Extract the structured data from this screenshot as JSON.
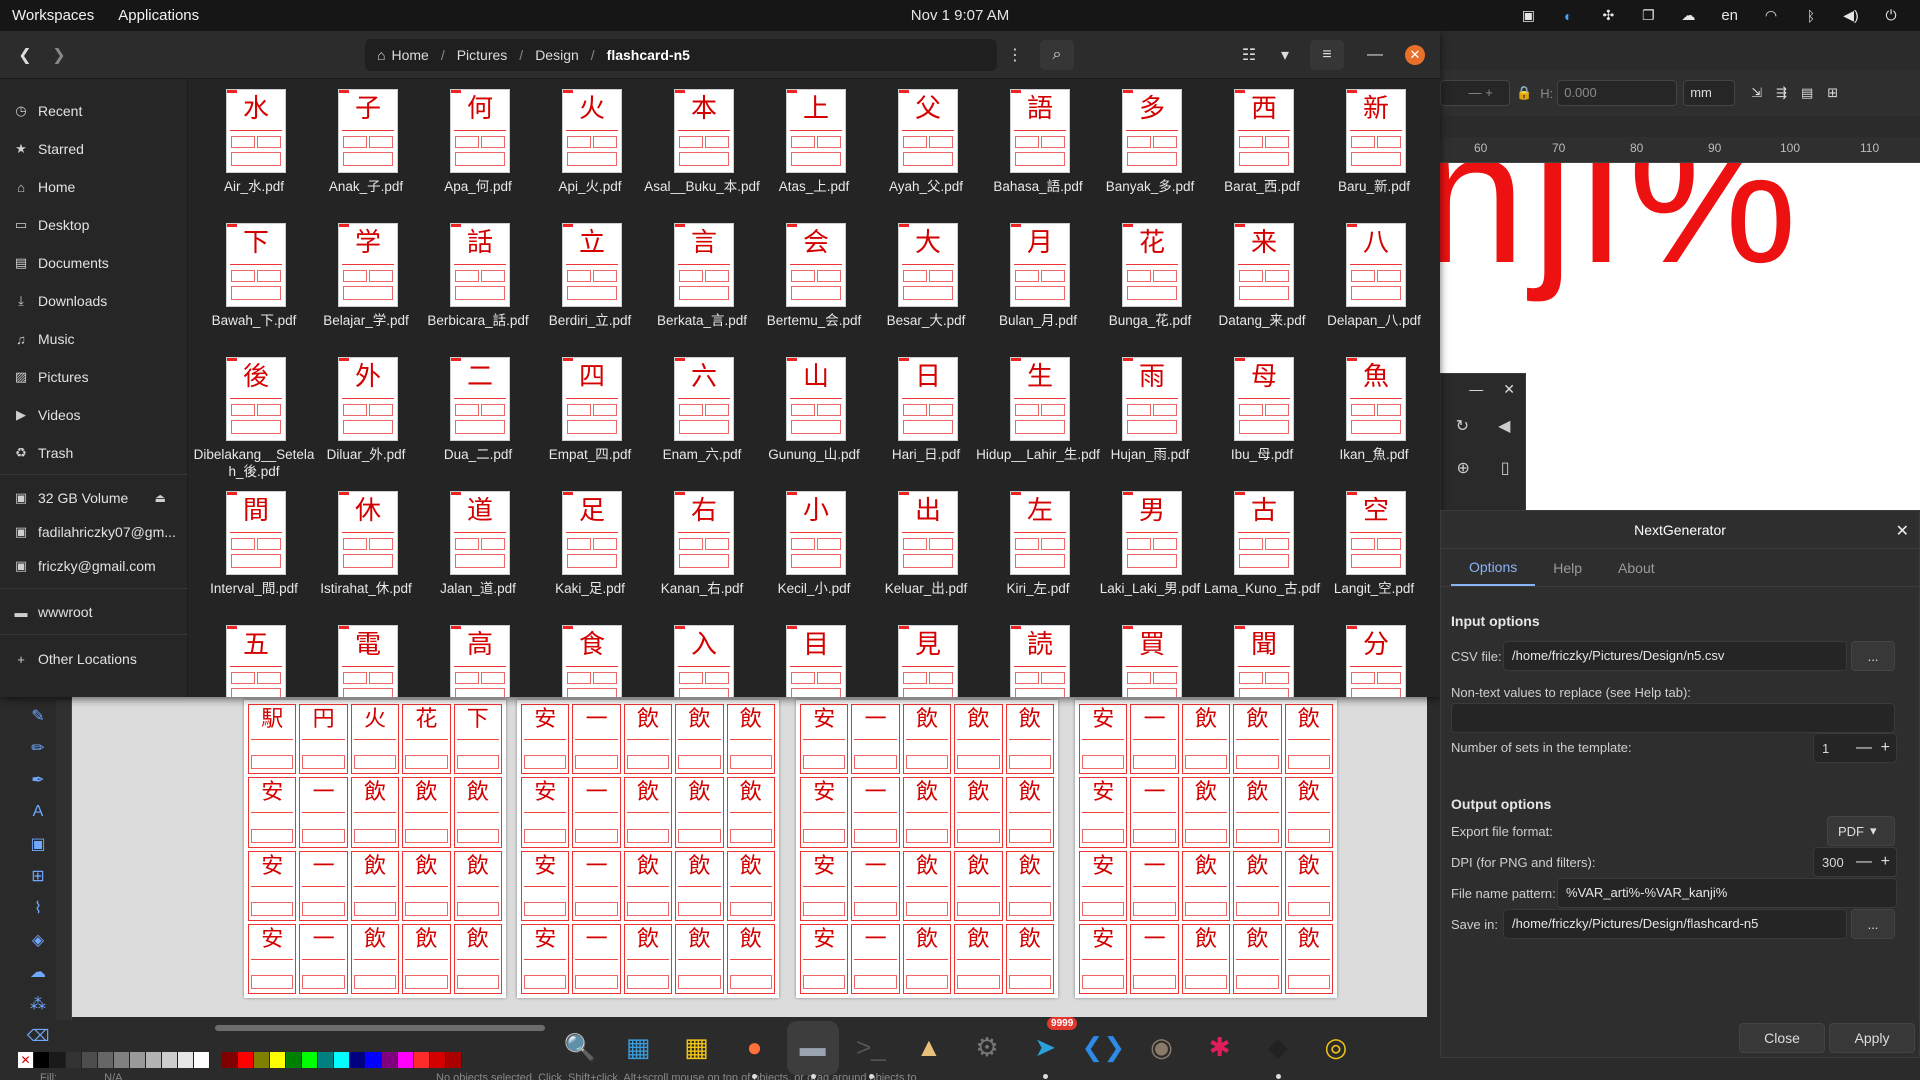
{
  "topbar": {
    "workspaces": "Workspaces",
    "applications": "Applications",
    "clock": "Nov 1  9:07 AM",
    "lang": "en",
    "tray_icons": [
      "screen-icon",
      "color-icon",
      "puzzle-icon",
      "window-icon",
      "cloud-icon",
      "wifi-icon",
      "bluetooth-icon",
      "volume-icon",
      "power-icon"
    ]
  },
  "filemanager": {
    "path": [
      "Home",
      "Pictures",
      "Design",
      "flashcard-n5"
    ],
    "sidebar": [
      {
        "icon": "clock-icon",
        "glyph": "◷",
        "label": "Recent"
      },
      {
        "icon": "star-icon",
        "glyph": "★",
        "label": "Starred"
      },
      {
        "icon": "home-icon",
        "glyph": "⌂",
        "label": "Home"
      },
      {
        "icon": "desktop-icon",
        "glyph": "▭",
        "label": "Desktop"
      },
      {
        "icon": "document-icon",
        "glyph": "▤",
        "label": "Documents"
      },
      {
        "icon": "download-icon",
        "glyph": "⤓",
        "label": "Downloads"
      },
      {
        "icon": "music-icon",
        "glyph": "♫",
        "label": "Music"
      },
      {
        "icon": "picture-icon",
        "glyph": "▨",
        "label": "Pictures"
      },
      {
        "icon": "video-icon",
        "glyph": "▶",
        "label": "Videos"
      },
      {
        "icon": "trash-icon",
        "glyph": "♻",
        "label": "Trash"
      },
      {
        "icon": "drive-icon",
        "glyph": "▣",
        "label": "32 GB Volume"
      },
      {
        "icon": "drive-icon",
        "glyph": "▣",
        "label": "fadilahriczky07@gm..."
      },
      {
        "icon": "drive-icon",
        "glyph": "▣",
        "label": "friczky@gmail.com"
      },
      {
        "icon": "folder-icon",
        "glyph": "▬",
        "label": "wwwroot"
      },
      {
        "icon": "plus-icon",
        "glyph": "+",
        "label": "Other Locations"
      }
    ],
    "files": [
      {
        "k": "水",
        "n": "Air_水.pdf"
      },
      {
        "k": "子",
        "n": "Anak_子.pdf"
      },
      {
        "k": "何",
        "n": "Apa_何.pdf"
      },
      {
        "k": "火",
        "n": "Api_火.pdf"
      },
      {
        "k": "本",
        "n": "Asal__Buku_本.pdf"
      },
      {
        "k": "上",
        "n": "Atas_上.pdf"
      },
      {
        "k": "父",
        "n": "Ayah_父.pdf"
      },
      {
        "k": "語",
        "n": "Bahasa_語.pdf"
      },
      {
        "k": "多",
        "n": "Banyak_多.pdf"
      },
      {
        "k": "西",
        "n": "Barat_西.pdf"
      },
      {
        "k": "新",
        "n": "Baru_新.pdf"
      },
      {
        "k": "下",
        "n": "Bawah_下.pdf"
      },
      {
        "k": "学",
        "n": "Belajar_学.pdf"
      },
      {
        "k": "話",
        "n": "Berbicara_話.pdf"
      },
      {
        "k": "立",
        "n": "Berdiri_立.pdf"
      },
      {
        "k": "言",
        "n": "Berkata_言.pdf"
      },
      {
        "k": "会",
        "n": "Bertemu_会.pdf"
      },
      {
        "k": "大",
        "n": "Besar_大.pdf"
      },
      {
        "k": "月",
        "n": "Bulan_月.pdf"
      },
      {
        "k": "花",
        "n": "Bunga_花.pdf"
      },
      {
        "k": "来",
        "n": "Datang_来.pdf"
      },
      {
        "k": "八",
        "n": "Delapan_八.pdf"
      },
      {
        "k": "後",
        "n": "Dibelakang__Setelah_後.pdf"
      },
      {
        "k": "外",
        "n": "Diluar_外.pdf"
      },
      {
        "k": "二",
        "n": "Dua_二.pdf"
      },
      {
        "k": "四",
        "n": "Empat_四.pdf"
      },
      {
        "k": "六",
        "n": "Enam_六.pdf"
      },
      {
        "k": "山",
        "n": "Gunung_山.pdf"
      },
      {
        "k": "日",
        "n": "Hari_日.pdf"
      },
      {
        "k": "生",
        "n": "Hidup__Lahir_生.pdf"
      },
      {
        "k": "雨",
        "n": "Hujan_雨.pdf"
      },
      {
        "k": "母",
        "n": "Ibu_母.pdf"
      },
      {
        "k": "魚",
        "n": "Ikan_魚.pdf"
      },
      {
        "k": "間",
        "n": "Interval_間.pdf"
      },
      {
        "k": "休",
        "n": "Istirahat_休.pdf"
      },
      {
        "k": "道",
        "n": "Jalan_道.pdf"
      },
      {
        "k": "足",
        "n": "Kaki_足.pdf"
      },
      {
        "k": "右",
        "n": "Kanan_右.pdf"
      },
      {
        "k": "小",
        "n": "Kecil_小.pdf"
      },
      {
        "k": "出",
        "n": "Keluar_出.pdf"
      },
      {
        "k": "左",
        "n": "Kiri_左.pdf"
      },
      {
        "k": "男",
        "n": "Laki_Laki_男.pdf"
      },
      {
        "k": "古",
        "n": "Lama_Kuno_古.pdf"
      },
      {
        "k": "空",
        "n": "Langit_空.pdf"
      },
      {
        "k": "五",
        "n": ""
      },
      {
        "k": "電",
        "n": ""
      },
      {
        "k": "高",
        "n": ""
      },
      {
        "k": "食",
        "n": ""
      },
      {
        "k": "入",
        "n": ""
      },
      {
        "k": "目",
        "n": ""
      },
      {
        "k": "見",
        "n": ""
      },
      {
        "k": "読",
        "n": ""
      },
      {
        "k": "買",
        "n": ""
      },
      {
        "k": "聞",
        "n": ""
      },
      {
        "k": "分",
        "n": ""
      }
    ]
  },
  "inkscape": {
    "canvas_text": "nji%",
    "h_label": "H:",
    "h_value": "0.000",
    "unit": "mm",
    "ruler_ticks": [
      "60",
      "70",
      "80",
      "90",
      "100",
      "110"
    ],
    "page1_kanji": [
      "駅",
      "円",
      "火",
      "花",
      "下",
      "安",
      "一",
      "飲",
      "飲",
      "飲",
      "安",
      "一",
      "飲",
      "飲",
      "飲",
      "安",
      "一",
      "飲",
      "飲",
      "飲"
    ],
    "page_kanji": [
      "安",
      "一",
      "飲",
      "飲",
      "飲",
      "安",
      "一",
      "飲",
      "飲",
      "飲",
      "安",
      "一",
      "飲",
      "飲",
      "飲",
      "安",
      "一",
      "飲",
      "飲",
      "飲"
    ],
    "status_fill": "Fill:",
    "status_na": "N/A",
    "status_text": "No objects selected. Click, Shift+click, Alt+scroll mouse on top of objects, or drag around objects to",
    "palette": [
      "#000000",
      "#1a1a1a",
      "#333333",
      "#4d4d4d",
      "#666666",
      "#808080",
      "#999999",
      "#b3b3b3",
      "#cccccc",
      "#e6e6e6",
      "#ffffff",
      "#800000",
      "#ff0000",
      "#808000",
      "#ffff00",
      "#008000",
      "#00ff00",
      "#008080",
      "#00ffff",
      "#000080",
      "#0000ff",
      "#800080",
      "#ff00ff",
      "#ff2a2a",
      "#d40000",
      "#aa0000"
    ]
  },
  "dialog": {
    "title": "NextGenerator",
    "tabs": [
      "Options",
      "Help",
      "About"
    ],
    "input_section": "Input options",
    "csv_label": "CSV file:",
    "csv_value": "/home/friczky/Pictures/Design/n5.csv",
    "browse": "...",
    "nontext_label": "Non-text values to replace (see Help tab):",
    "nontext_value": "",
    "sets_label": "Number of sets in the template:",
    "sets_value": "1",
    "output_section": "Output options",
    "format_label": "Export file format:",
    "format_value": "PDF",
    "dpi_label": "DPI (for PNG and filters):",
    "dpi_value": "300",
    "pattern_label": "File name pattern:",
    "pattern_value": "%VAR_arti%-%VAR_kanji%",
    "savein_label": "Save in:",
    "savein_value": "/home/friczky/Pictures/Design/flashcard-n5",
    "close": "Close",
    "apply": "Apply"
  },
  "dock": {
    "apps": [
      {
        "name": "search-app-icon",
        "glyph": "🔍",
        "color": "#2aa7c9"
      },
      {
        "name": "screenshot-app-icon",
        "glyph": "▦",
        "color": "#3b9ad9"
      },
      {
        "name": "app-grid-icon",
        "glyph": "▦",
        "color": "#f0c419"
      },
      {
        "name": "firefox-icon",
        "glyph": "●",
        "color": "#ff7139"
      },
      {
        "name": "files-icon",
        "glyph": "▬",
        "color": "#9aa5b1"
      },
      {
        "name": "terminal-icon",
        "glyph": ">_",
        "color": "#555555"
      },
      {
        "name": "inkscape-app-icon",
        "glyph": "▲",
        "color": "#e8c07a"
      },
      {
        "name": "settings-icon",
        "glyph": "⚙",
        "color": "#777777"
      },
      {
        "name": "telegram-icon",
        "glyph": "➤",
        "color": "#2aa1da"
      },
      {
        "name": "vscode-icon",
        "glyph": "❮❯",
        "color": "#2d8ae5"
      },
      {
        "name": "gimp-icon",
        "glyph": "◉",
        "color": "#8a7a6a"
      },
      {
        "name": "slack-icon",
        "glyph": "✱",
        "color": "#e01e5a"
      },
      {
        "name": "inkscape-icon",
        "glyph": "◆",
        "color": "#222222"
      },
      {
        "name": "disk-icon",
        "glyph": "◎",
        "color": "#f0c419"
      }
    ],
    "telegram_badge": "9999"
  }
}
